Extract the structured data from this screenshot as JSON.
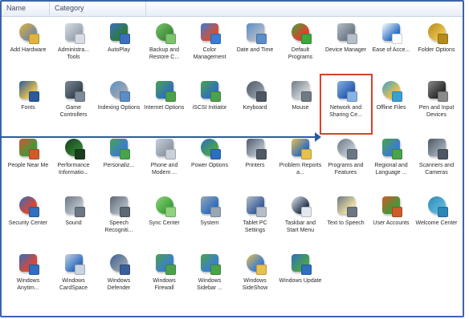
{
  "header": {
    "columns": [
      "Name",
      "Category"
    ]
  },
  "items": [
    {
      "label": "Add Hardware",
      "icon": "add-hardware-icon",
      "color": "#7c8a99",
      "accent": "#e2b33c"
    },
    {
      "label": "Administra... Tools",
      "icon": "admin-tools-icon",
      "color": "#9aa7b4",
      "accent": "#d8dde4"
    },
    {
      "label": "AutoPlay",
      "icon": "autoplay-icon",
      "color": "#2c7a3a",
      "accent": "#3c6fc0"
    },
    {
      "label": "Backup and Restore C...",
      "icon": "backup-icon",
      "color": "#3f8e3a",
      "accent": "#7cc46c"
    },
    {
      "label": "Color Management",
      "icon": "color-management-icon",
      "color": "#d94f2e",
      "accent": "#3a7bd5"
    },
    {
      "label": "Date and Time",
      "icon": "date-time-icon",
      "color": "#aab7c6",
      "accent": "#5b8dc9"
    },
    {
      "label": "Default Programs",
      "icon": "default-programs-icon",
      "color": "#e63b2a",
      "accent": "#3ca83c"
    },
    {
      "label": "Device Manager",
      "icon": "device-manager-icon",
      "color": "#6d7a88",
      "accent": "#b5bec8"
    },
    {
      "label": "Ease of Acce...",
      "icon": "ease-of-access-icon",
      "color": "#2d6fc4",
      "accent": "#ffffff"
    },
    {
      "label": "Folder Options",
      "icon": "folder-options-icon",
      "color": "#e8c04c",
      "accent": "#b58a1d"
    },
    {
      "label": "Fonts",
      "icon": "fonts-icon",
      "color": "#e6c04a",
      "accent": "#2b5aa0"
    },
    {
      "label": "Game Controllers",
      "icon": "game-controller-icon",
      "color": "#3b4654",
      "accent": "#7f8b98"
    },
    {
      "label": "Indexing Options",
      "icon": "indexing-icon",
      "color": "#9aa6b3",
      "accent": "#5b8dc9"
    },
    {
      "label": "Internet Options",
      "icon": "internet-options-icon",
      "color": "#2f6ec0",
      "accent": "#4aa34a"
    },
    {
      "label": "iSCSI Initiator",
      "icon": "iscsi-icon",
      "color": "#2f6ec0",
      "accent": "#4aa34a"
    },
    {
      "label": "Keyboard",
      "icon": "keyboard-icon",
      "color": "#8a96a3",
      "accent": "#4d5763"
    },
    {
      "label": "Mouse",
      "icon": "mouse-icon",
      "color": "#c9ced4",
      "accent": "#707a85"
    },
    {
      "label": "Network and Sharing Ce...",
      "icon": "network-sharing-icon",
      "color": "#2a5db0",
      "accent": "#87b2e4"
    },
    {
      "label": "Offline Files",
      "icon": "offline-files-icon",
      "color": "#e6c04a",
      "accent": "#3aa0d4"
    },
    {
      "label": "Pen and Input Devices",
      "icon": "pen-input-icon",
      "color": "#2c2c2c",
      "accent": "#8a8a8a"
    },
    {
      "label": "People Near Me",
      "icon": "people-near-me-icon",
      "color": "#3d9a3a",
      "accent": "#d05a2a"
    },
    {
      "label": "Performance Informatio...",
      "icon": "performance-icon",
      "color": "#2e7d32",
      "accent": "#1b3d1c"
    },
    {
      "label": "Personaliz...",
      "icon": "personalization-icon",
      "color": "#3a7bd5",
      "accent": "#4aa34a"
    },
    {
      "label": "Phone and Modem ...",
      "icon": "phone-modem-icon",
      "color": "#8f9aa6",
      "accent": "#c9d0d8"
    },
    {
      "label": "Power Options",
      "icon": "power-options-icon",
      "color": "#4aa34a",
      "accent": "#2c6ec0"
    },
    {
      "label": "Printers",
      "icon": "printers-icon",
      "color": "#aeb8c3",
      "accent": "#4f5a66"
    },
    {
      "label": "Problem Reports a...",
      "icon": "problem-reports-icon",
      "color": "#2f6ec0",
      "accent": "#e8c04c"
    },
    {
      "label": "Programs and Features",
      "icon": "programs-features-icon",
      "color": "#b8c2cc",
      "accent": "#6a7683"
    },
    {
      "label": "Regional and Language ...",
      "icon": "regional-language-icon",
      "color": "#3a7bd5",
      "accent": "#4aa34a"
    },
    {
      "label": "Scanners and Cameras",
      "icon": "scanners-cameras-icon",
      "color": "#9aa6b3",
      "accent": "#4d5763"
    },
    {
      "label": "Security Center",
      "icon": "security-center-icon",
      "color": "#e3452c",
      "accent": "#2f6ec0"
    },
    {
      "label": "Sound",
      "icon": "sound-icon",
      "color": "#b5bec8",
      "accent": "#6c7784"
    },
    {
      "label": "Speech Recogniti...",
      "icon": "speech-recognition-icon",
      "color": "#a8b2bd",
      "accent": "#5d6873"
    },
    {
      "label": "Sync Center",
      "icon": "sync-center-icon",
      "color": "#3fa33a",
      "accent": "#8fd27c"
    },
    {
      "label": "System",
      "icon": "system-icon",
      "color": "#2f6ec0",
      "accent": "#9aa6b3"
    },
    {
      "label": "Tablet PC Settings",
      "icon": "tablet-pc-icon",
      "color": "#3a5f9a",
      "accent": "#b5bec8"
    },
    {
      "label": "Taskbar and Start Menu",
      "icon": "taskbar-icon",
      "color": "#2c3e58",
      "accent": "#e4e8ee"
    },
    {
      "label": "Text to Speech",
      "icon": "text-to-speech-icon",
      "color": "#e8dca0",
      "accent": "#6c7784"
    },
    {
      "label": "User Accounts",
      "icon": "user-accounts-icon",
      "color": "#3d9a3a",
      "accent": "#d05a2a"
    },
    {
      "label": "Welcome Center",
      "icon": "welcome-center-icon",
      "color": "#5ab6d8",
      "accent": "#2e86b8"
    },
    {
      "label": "Windows Anytim...",
      "icon": "windows-anytime-icon",
      "color": "#e3452c",
      "accent": "#2f6ec0"
    },
    {
      "label": "Windows CardSpace",
      "icon": "cardspace-icon",
      "color": "#2f6ec0",
      "accent": "#c9d3e1"
    },
    {
      "label": "Windows Defender",
      "icon": "defender-icon",
      "color": "#8f9aa6",
      "accent": "#3a5f9a"
    },
    {
      "label": "Windows Firewall",
      "icon": "firewall-icon",
      "color": "#3a7bd5",
      "accent": "#4aa34a"
    },
    {
      "label": "Windows Sidebar ...",
      "icon": "sidebar-icon",
      "color": "#3a7bd5",
      "accent": "#4aa34a"
    },
    {
      "label": "Windows SideShow",
      "icon": "sideshow-icon",
      "color": "#3a7bd5",
      "accent": "#e8c04c"
    },
    {
      "label": "Windows Update",
      "icon": "windows-update-icon",
      "color": "#4aa34a",
      "accent": "#2f6ec0"
    }
  ],
  "highlighted_item": "Network and Sharing Ce...",
  "colors": {
    "highlight_border": "#d8432a",
    "pointer_arrow": "#2b5aa0",
    "window_border": "#3a66a8"
  }
}
